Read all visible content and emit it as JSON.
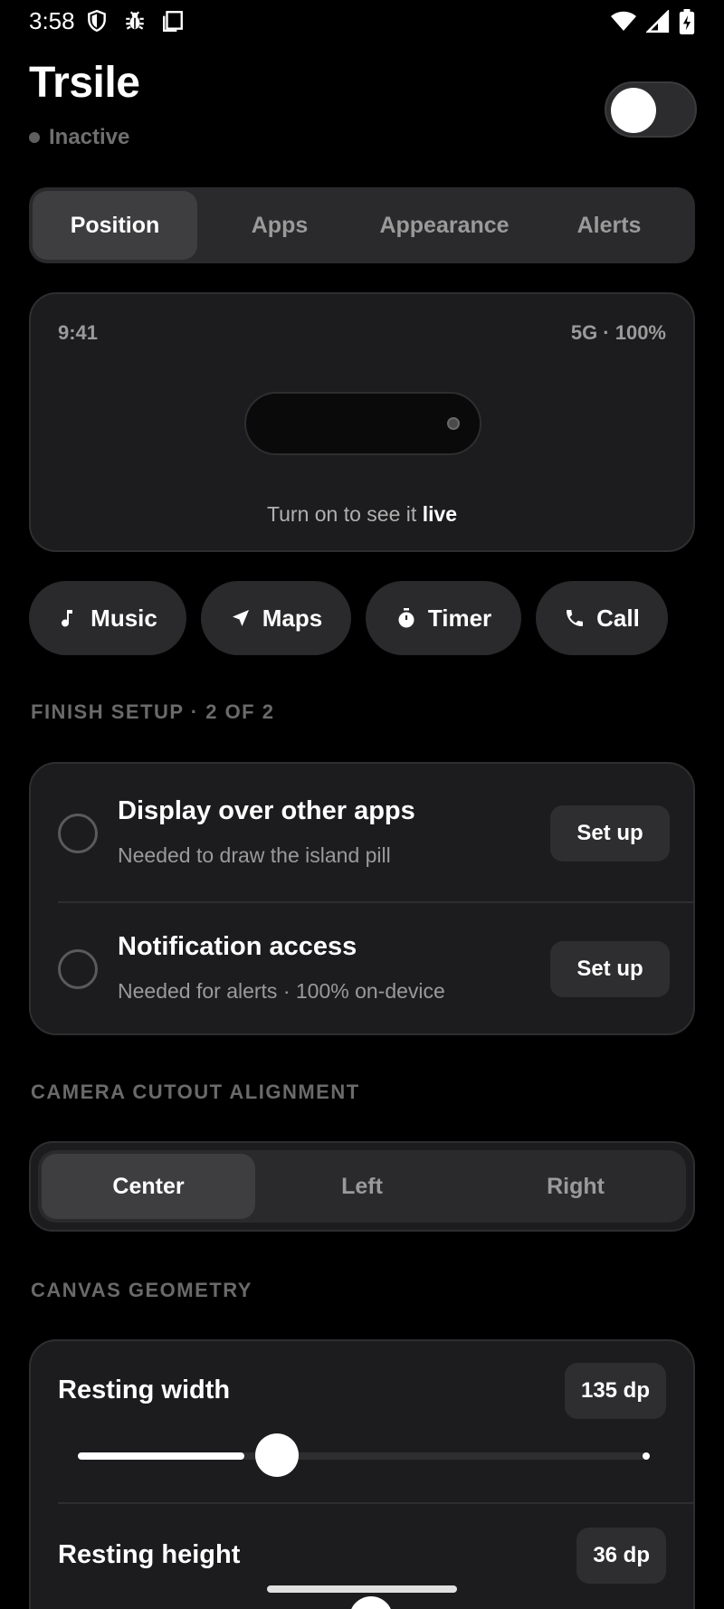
{
  "status_bar": {
    "time": "3:58",
    "left_icons": [
      "shield-icon",
      "bug-icon",
      "screenshot-icon"
    ],
    "right_icons": [
      "wifi-icon",
      "cell-signal-icon",
      "battery-charging-icon"
    ]
  },
  "header": {
    "title": "Trsile",
    "status": "Inactive",
    "toggle_on": false
  },
  "tabs": [
    {
      "label": "Position",
      "active": true
    },
    {
      "label": "Apps",
      "active": false
    },
    {
      "label": "Appearance",
      "active": false
    },
    {
      "label": "Alerts",
      "active": false
    }
  ],
  "preview": {
    "time": "9:41",
    "network": "5G · 100%",
    "caption_prefix": "Turn on to see it ",
    "caption_emphasis": "live"
  },
  "chips": [
    {
      "label": "Music",
      "icon": "music-note-icon"
    },
    {
      "label": "Maps",
      "icon": "navigation-arrow-icon"
    },
    {
      "label": "Timer",
      "icon": "stopwatch-icon"
    },
    {
      "label": "Call",
      "icon": "phone-icon"
    }
  ],
  "setup": {
    "section_label": "FINISH SETUP · 2 OF 2",
    "items": [
      {
        "title": "Display over other apps",
        "subtitle": "Needed to draw the island pill",
        "button": "Set up",
        "done": false
      },
      {
        "title": "Notification access",
        "subtitle": "Needed for alerts · 100% on-device",
        "button": "Set up",
        "done": false
      }
    ]
  },
  "alignment": {
    "section_label": "CAMERA CUTOUT ALIGNMENT",
    "options": [
      {
        "label": "Center",
        "active": true
      },
      {
        "label": "Left",
        "active": false
      },
      {
        "label": "Right",
        "active": false
      }
    ]
  },
  "geometry": {
    "section_label": "CANVAS GEOMETRY",
    "resting_width": {
      "label": "Resting width",
      "value": "135 dp",
      "fraction": 0.31
    },
    "resting_height": {
      "label": "Resting height",
      "value": "36 dp"
    }
  },
  "colors": {
    "background": "#000000",
    "card": "#1c1c1e",
    "surface": "#2a2a2c",
    "muted_text": "#9a9a9a"
  }
}
